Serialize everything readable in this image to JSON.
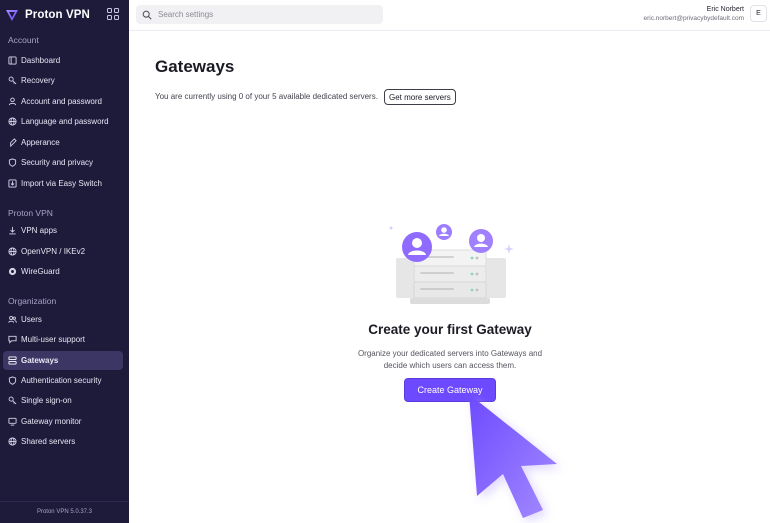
{
  "app": {
    "name": "Proton VPN",
    "version": "Proton VPN 5.0.37.3"
  },
  "sidebar": {
    "sections": [
      {
        "title": "Account"
      },
      {
        "title": "Proton VPN"
      },
      {
        "title": "Organization"
      }
    ],
    "items": [
      {
        "label": "Dashboard",
        "icon": "dashboard-icon"
      },
      {
        "label": "Recovery",
        "icon": "key-icon"
      },
      {
        "label": "Account and password",
        "icon": "user-icon"
      },
      {
        "label": "Language and password",
        "icon": "globe-icon"
      },
      {
        "label": "Apperance",
        "icon": "palette-icon"
      },
      {
        "label": "Security and privacy",
        "icon": "shield-icon"
      },
      {
        "label": "Import via Easy Switch",
        "icon": "import-icon"
      },
      {
        "label": "VPN apps",
        "icon": "download-icon"
      },
      {
        "label": "OpenVPN / IKEv2",
        "icon": "globe-icon"
      },
      {
        "label": "WireGuard",
        "icon": "wireguard-icon"
      },
      {
        "label": "Users",
        "icon": "users-icon"
      },
      {
        "label": "Multi-user support",
        "icon": "chat-icon"
      },
      {
        "label": "Gateways",
        "icon": "server-icon",
        "active": true
      },
      {
        "label": "Authentication security",
        "icon": "shield-icon"
      },
      {
        "label": "Single sign-on",
        "icon": "key-icon"
      },
      {
        "label": "Gateway monitor",
        "icon": "monitor-icon"
      },
      {
        "label": "Shared servers",
        "icon": "globe-icon"
      }
    ]
  },
  "header": {
    "search_placeholder": "Search settings",
    "user_name": "Eric Norbert",
    "user_email": "eric.norbert@privacybydefault.com",
    "avatar_initial": "E"
  },
  "main": {
    "title": "Gateways",
    "usage_text": "You are currently using 0 of your 5 available dedicated servers.",
    "more_servers_label": "Get more servers",
    "empty_title": "Create your first Gateway",
    "empty_desc_line1": "Organize your dedicated servers into Gateways and",
    "empty_desc_line2": "decide which users can access them.",
    "create_label": "Create Gateway"
  },
  "colors": {
    "sidebar_bg": "#1d1a3a",
    "accent": "#6d4aff",
    "active_item": "#3b3663"
  }
}
